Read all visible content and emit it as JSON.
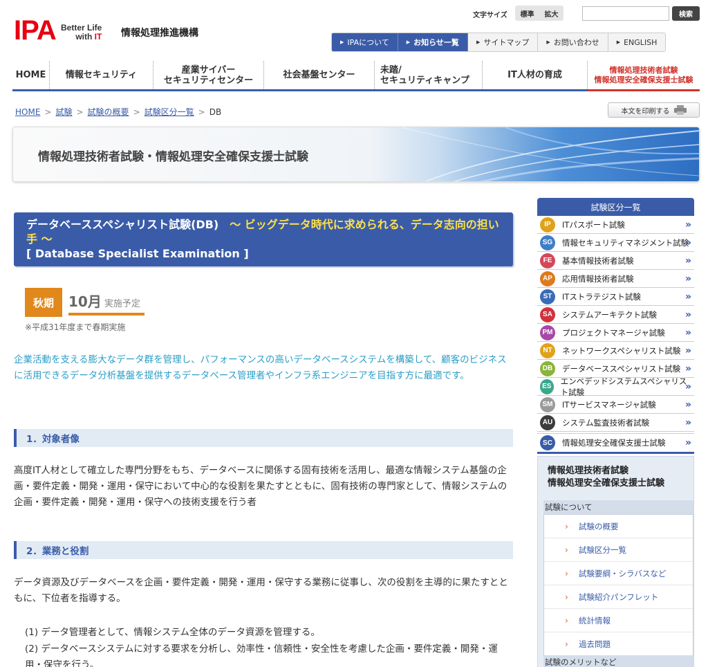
{
  "header": {
    "logo": "IPA",
    "tagline1": "Better Life",
    "tagline2a": "with ",
    "tagline2b": "IT",
    "org_name": "情報処理推進機構",
    "font_size_label": "文字サイズ",
    "font_size_standard": "標準",
    "font_size_large": "拡大",
    "search_button": "検索"
  },
  "top_nav": [
    {
      "label": "IPAについて"
    },
    {
      "label": "お知らせ一覧"
    },
    {
      "label": "サイトマップ"
    },
    {
      "label": "お問い合わせ"
    },
    {
      "label": "ENGLISH"
    }
  ],
  "main_nav": {
    "home": "HOME",
    "security": "情報セキュリティ",
    "cyber_1": "産業サイバー",
    "cyber_2": "セキュリティセンター",
    "social": "社会基盤センター",
    "camp_1": "未踏/",
    "camp_2": "セキュリティキャンプ",
    "itjinzai": "IT人材の育成",
    "exam_1": "情報処理技術者試験",
    "exam_2": "情報処理安全確保支援士試験"
  },
  "breadcrumb": {
    "home": "HOME",
    "exam": "試験",
    "overview": "試験の概要",
    "list": "試験区分一覧",
    "current": "DB",
    "sep": ">"
  },
  "print_label": "本文を印刷する",
  "banner_title": "情報処理技術者試験・情報処理安全確保支援士試験",
  "exam": {
    "title_white": "データベーススペシャリスト試験(DB)",
    "title_yellow": "〜 ビッグデータ時代に求められる、データ志向の担い手 〜",
    "title_en": "[ Database Specialist Examination ]",
    "season": "秋期",
    "month": "10月",
    "schedule": "実施予定",
    "season_note": "※平成31年度まで春期実施"
  },
  "lead": "企業活動を支える膨大なデータ群を管理し、パフォーマンスの高いデータベースシステムを構築して、顧客のビジネスに活用できるデータ分析基盤を提供するデータベース管理者やインフラ系エンジニアを目指す方に最適です。",
  "sections": {
    "s1_title": "1．対象者像",
    "s1_body": "高度IT人材として確立した専門分野をもち、データベースに関係する固有技術を活用し、最適な情報システム基盤の企画・要件定義・開発・運用・保守において中心的な役割を果たすとともに、固有技術の専門家として、情報システムの企画・要件定義・開発・運用・保守への技術支援を行う者",
    "s2_title": "2．業務と役割",
    "s2_body": "データ資源及びデータベースを企画・要件定義・開発・運用・保守する業務に従事し、次の役割を主導的に果たすとともに、下位者を指導する。",
    "li1": "(1) データ管理者として、情報システム全体のデータ資源を管理する。",
    "li2": "(2) データベースシステムに対する要求を分析し、効率性・信頼性・安全性を考慮した企画・要件定義・開発・運用・保守を行う。"
  },
  "sidebar": {
    "head": "試験区分一覧",
    "items": [
      {
        "code": "IP",
        "label": "ITパスポート試験",
        "color": "#e0a21a"
      },
      {
        "code": "SG",
        "label": "情報セキュリティマネジメント試験",
        "color": "#3e7fc8"
      },
      {
        "code": "FE",
        "label": "基本情報技術者試験",
        "color": "#d2485a"
      },
      {
        "code": "AP",
        "label": "応用情報技術者試験",
        "color": "#e0781c"
      },
      {
        "code": "ST",
        "label": "ITストラテジスト試験",
        "color": "#3a6cb6"
      },
      {
        "code": "SA",
        "label": "システムアーキテクト試験",
        "color": "#d2323c"
      },
      {
        "code": "PM",
        "label": "プロジェクトマネージャ試験",
        "color": "#a848a8"
      },
      {
        "code": "NT",
        "label": "ネットワークスペシャリスト試験",
        "color": "#e0a21a"
      },
      {
        "code": "DB",
        "label": "データベーススペシャリスト試験",
        "color": "#8ab43a"
      },
      {
        "code": "ES",
        "label": "エンベデッドシステムスペシャリスト試験",
        "color": "#3aa88c"
      },
      {
        "code": "SM",
        "label": "ITサービスマネージャ試験",
        "color": "#9a9a9a"
      },
      {
        "code": "AU",
        "label": "システム監査技術者試験",
        "color": "#3c3c3c"
      }
    ],
    "wide_item": {
      "code": "SC",
      "label": "情報処理安全確保支援士試験",
      "color": "#3a5ca8"
    },
    "box_title_1": "情報処理技術者試験",
    "box_title_2": "情報処理安全確保支援士試験",
    "box_sub": "試験について",
    "links": [
      "試験の概要",
      "試験区分一覧",
      "試験要綱・シラバスなど",
      "試験紹介パンフレット",
      "統計情報",
      "過去問題"
    ],
    "box_sub2": "試験のメリットなど"
  }
}
